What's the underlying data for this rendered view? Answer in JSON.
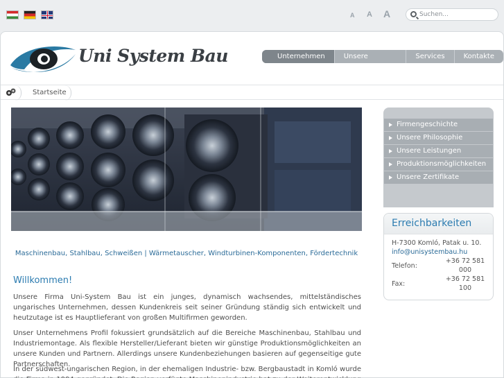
{
  "topbar": {
    "languages": [
      "hu",
      "de",
      "en"
    ],
    "font_sizes": [
      "A",
      "A",
      "A"
    ],
    "search": {
      "placeholder": "Suchen..."
    }
  },
  "header": {
    "logo_text": "Uni System Bau",
    "nav": [
      "Unternehmen",
      "Unsere Produkte",
      "Services",
      "Kontakte"
    ],
    "active_nav": "Unternehmen"
  },
  "breadcrumb": {
    "current": "Startseite"
  },
  "content": {
    "tagline": "Maschinenbau, Stahlbau, Schweißen | Wärmetauscher, Windturbinen-Komponenten, Fördertechnik",
    "heading": "Willkommen!",
    "paragraphs": [
      "Unsere Firma Uni-System Bau ist ein junges, dynamisch wachsendes, mittelständisches ungarisches Unternehmen, dessen Kundenkreis seit seiner Gründung ständig sich entwickelt und heutzutage ist es Hauptlieferant von großen Multifirmen geworden.",
      "Unser Unternehmens Profil fokussiert grundsätzlich auf die Bereiche Maschinenbau, Stahlbau und Industriemontage. Als flexible Hersteller/Lieferant bieten wir günstige Produktionsmöglichkeiten an unsere Kunden und Partnern. Allerdings unsere Kundenbeziehungen basieren auf gegenseitige gute Partnerschaften.",
      "In der südwest-ungarischen Region, in der ehemaligen Industrie- bzw. Bergbaustadt in Komló wurde die Firma in 1994 gegründet. Die Region verfügte Maschinenindustrie hat zu der Weiterentwicklung der Fa. Uni-System Bau"
    ]
  },
  "sidebar": {
    "items": [
      "Firmengeschichte",
      "Unsere Philosophie",
      "Unsere Leistungen",
      "Produktionsmöglichkeiten",
      "Unsere Zertifikate"
    ]
  },
  "contact": {
    "title": "Erreichbarkeiten",
    "address": "H-7300 Komló, Patak u. 10.",
    "email": "info@unisystembau.hu",
    "telefon_label": "Telefon:",
    "telefon_value": "+36 72 581 000",
    "fax_label": "Fax:",
    "fax_value": "+36 72 581 100"
  }
}
